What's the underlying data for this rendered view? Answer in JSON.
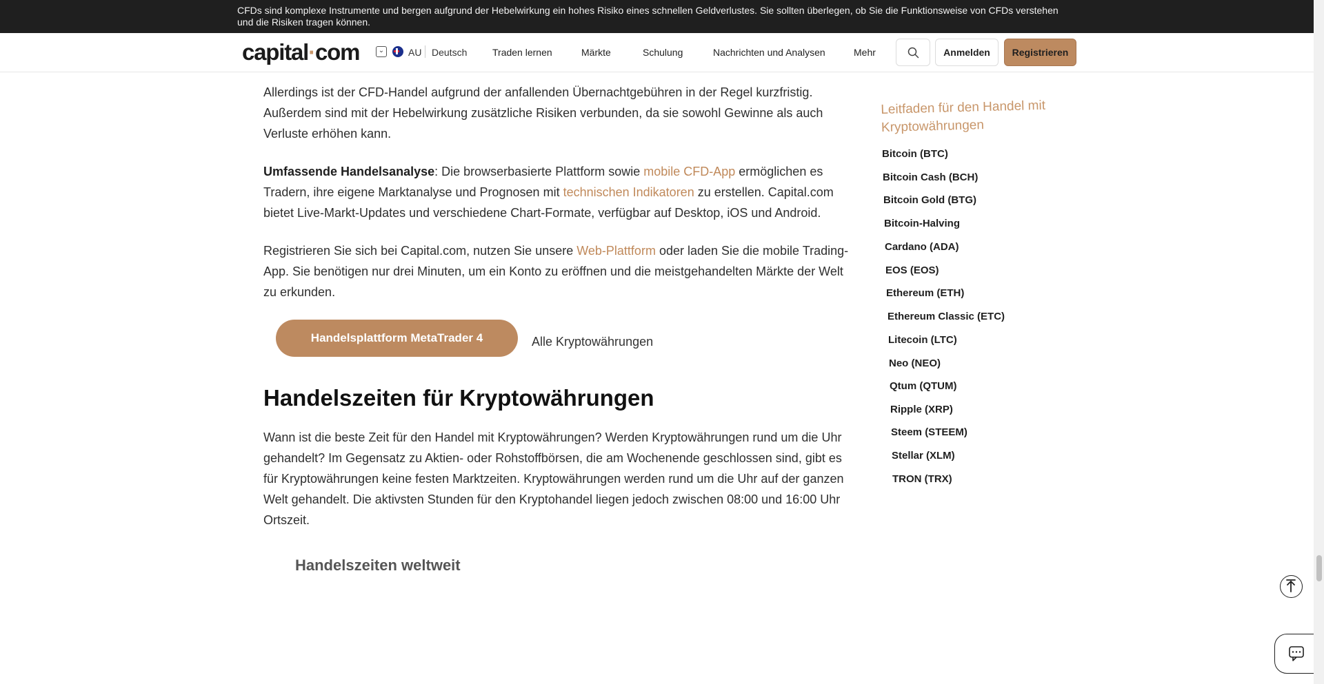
{
  "risk_banner": {
    "text": "CFDs sind komplexe Instrumente und bergen aufgrund der Hebelwirkung ein hohes Risiko eines schnellen Geldverlustes. Sie sollten überlegen, ob Sie die Funktionsweise von CFDs verstehen und die Risiken tragen können."
  },
  "header": {
    "logo_main": "capital",
    "logo_dot": "·",
    "logo_tld": "com",
    "country": "AU",
    "language": "Deutsch",
    "nav": [
      {
        "label": "Traden lernen"
      },
      {
        "label": "Märkte"
      },
      {
        "label": "Schulung"
      },
      {
        "label": "Nachrichten und Analysen"
      },
      {
        "label": "Mehr"
      }
    ],
    "login_label": "Anmelden",
    "register_label": "Registrieren"
  },
  "article": {
    "p1": "Allerdings ist der CFD-Handel aufgrund der anfallenden Übernachtgebühren in der Regel kurzfristig. Außerdem sind mit der Hebelwirkung zusätzliche Risiken verbunden, da sie sowohl Gewinne als auch Verluste erhöhen kann.",
    "p2": {
      "strong": "Umfassende Handelsanalyse",
      "t1": ": Die browserbasierte Plattform sowie ",
      "link1": "mobile CFD-App",
      "t2": " ermöglichen es Tradern, ihre eigene Marktanalyse und Prognosen mit ",
      "link2": "technischen Indikatoren",
      "t3": " zu erstellen. Capital.com bietet Live-Markt-Updates und verschiedene Chart-Formate, verfügbar auf Desktop, iOS und Android."
    },
    "p3": {
      "t1": "Registrieren Sie sich bei Capital.com, nutzen Sie unsere ",
      "link": "Web-Plattform",
      "t2": " oder laden Sie die mobile Trading-App. Sie benötigen nur drei Minuten, um ein Konto zu eröffnen und die meistgehandelten Märkte der Welt zu erkunden."
    },
    "cta_button": "Handelsplattform MetaTrader 4",
    "cta_link": "Alle Kryptowährungen",
    "section_heading": "Handelszeiten für Kryptowährungen",
    "p4": "Wann ist die beste Zeit für den Handel mit Kryptowährungen? Werden Kryptowährungen rund um die Uhr gehandelt? Im Gegensatz zu Aktien- oder Rohstoffbörsen, die am Wochenende geschlossen sind, gibt es für Kryptowährungen keine festen Marktzeiten. Kryptowährungen werden rund um die Uhr auf der ganzen Welt gehandelt. Die aktivsten Stunden für den Kryptohandel liegen jedoch zwischen 08:00 und 16:00 Uhr Ortszeit.",
    "sub_heading": "Handelszeiten weltweit"
  },
  "sidebar": {
    "title": "Leitfaden für den Handel mit Kryptowährungen",
    "items": [
      {
        "label": "Bitcoin (BTC)"
      },
      {
        "label": "Bitcoin Cash (BCH)"
      },
      {
        "label": "Bitcoin Gold (BTG)"
      },
      {
        "label": "Bitcoin-Halving"
      },
      {
        "label": "Cardano (ADA)"
      },
      {
        "label": "EOS (EOS)"
      },
      {
        "label": "Ethereum (ETH)"
      },
      {
        "label": "Ethereum Classic (ETC)"
      },
      {
        "label": "Litecoin (LTC)"
      },
      {
        "label": "Neo (NEO)"
      },
      {
        "label": "Qtum (QTUM)"
      },
      {
        "label": "Ripple (XRP)"
      },
      {
        "label": "Steem (STEEM)"
      },
      {
        "label": "Stellar (XLM)"
      },
      {
        "label": "TRON (TRX)"
      }
    ]
  },
  "icons": {
    "search": "search-icon",
    "scroll_top": "arrow-up-icon",
    "chat": "chat-icon",
    "flag": "australia-flag-icon",
    "language": "chevron-down-icon"
  },
  "colors": {
    "accent": "#bd8a60",
    "link": "#c0895a",
    "banner_bg": "#1f1f1f"
  }
}
